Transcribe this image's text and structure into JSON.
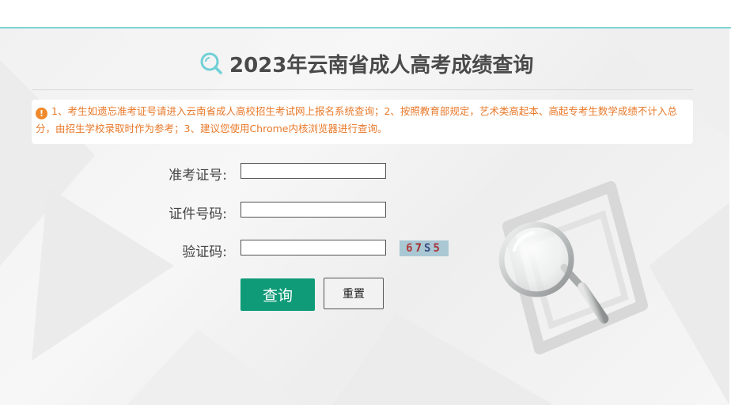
{
  "page": {
    "title": "2023年云南省成人高考成绩查询"
  },
  "notice": {
    "icon": "exclamation-icon",
    "text": "1、考生如遗忘准考证号请进入云南省成人高校招生考试网上报名系统查询；2、按照教育部规定，艺术类高起本、高起专考生数学成绩不计入总分，由招生学校录取时作为参考；3、建议您使用Chrome内核浏览器进行查询。"
  },
  "form": {
    "exam_no_label": "准考证号:",
    "exam_no_value": "",
    "id_no_label": "证件号码:",
    "id_no_value": "",
    "captcha_label": "验证码:",
    "captcha_value": "",
    "captcha_chars": [
      "6",
      "7",
      "S",
      "5"
    ]
  },
  "buttons": {
    "query_label": "查询",
    "reset_label": "重置"
  },
  "colors": {
    "accent_teal": "#7fd3d3",
    "query_button": "#0f9b78",
    "notice_text": "#e8792a"
  }
}
